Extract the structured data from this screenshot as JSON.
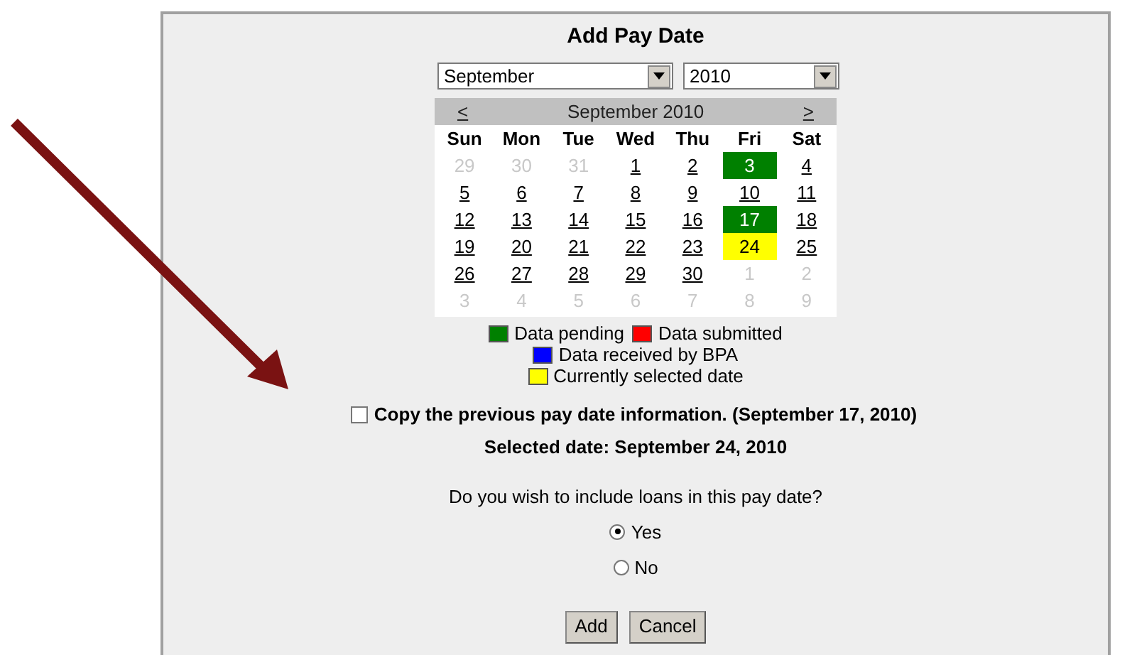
{
  "title": "Add Pay Date",
  "month_select": {
    "value": "September"
  },
  "year_select": {
    "value": "2010"
  },
  "calendar": {
    "prev": "<",
    "caption": "September 2010",
    "next": ">",
    "weekdays": [
      "Sun",
      "Mon",
      "Tue",
      "Wed",
      "Thu",
      "Fri",
      "Sat"
    ],
    "weeks": [
      [
        {
          "label": "29",
          "in_month": false
        },
        {
          "label": "30",
          "in_month": false
        },
        {
          "label": "31",
          "in_month": false
        },
        {
          "label": "1",
          "in_month": true
        },
        {
          "label": "2",
          "in_month": true
        },
        {
          "label": "3",
          "in_month": true,
          "color": "#008000"
        },
        {
          "label": "4",
          "in_month": true
        }
      ],
      [
        {
          "label": "5",
          "in_month": true
        },
        {
          "label": "6",
          "in_month": true
        },
        {
          "label": "7",
          "in_month": true
        },
        {
          "label": "8",
          "in_month": true
        },
        {
          "label": "9",
          "in_month": true
        },
        {
          "label": "10",
          "in_month": true
        },
        {
          "label": "11",
          "in_month": true
        }
      ],
      [
        {
          "label": "12",
          "in_month": true
        },
        {
          "label": "13",
          "in_month": true
        },
        {
          "label": "14",
          "in_month": true
        },
        {
          "label": "15",
          "in_month": true
        },
        {
          "label": "16",
          "in_month": true
        },
        {
          "label": "17",
          "in_month": true,
          "color": "#008000"
        },
        {
          "label": "18",
          "in_month": true
        }
      ],
      [
        {
          "label": "19",
          "in_month": true
        },
        {
          "label": "20",
          "in_month": true
        },
        {
          "label": "21",
          "in_month": true
        },
        {
          "label": "22",
          "in_month": true
        },
        {
          "label": "23",
          "in_month": true
        },
        {
          "label": "24",
          "in_month": true,
          "color": "#ffff00"
        },
        {
          "label": "25",
          "in_month": true
        }
      ],
      [
        {
          "label": "26",
          "in_month": true
        },
        {
          "label": "27",
          "in_month": true
        },
        {
          "label": "28",
          "in_month": true
        },
        {
          "label": "29",
          "in_month": true
        },
        {
          "label": "30",
          "in_month": true
        },
        {
          "label": "1",
          "in_month": false
        },
        {
          "label": "2",
          "in_month": false
        }
      ],
      [
        {
          "label": "3",
          "in_month": false
        },
        {
          "label": "4",
          "in_month": false
        },
        {
          "label": "5",
          "in_month": false
        },
        {
          "label": "6",
          "in_month": false
        },
        {
          "label": "7",
          "in_month": false
        },
        {
          "label": "8",
          "in_month": false
        },
        {
          "label": "9",
          "in_month": false
        }
      ]
    ]
  },
  "legend": [
    [
      {
        "label": "Data pending",
        "color": "#008000"
      },
      {
        "label": "Data submitted",
        "color": "#ff0000"
      }
    ],
    [
      {
        "label": "Data received by BPA",
        "color": "#0000ff"
      }
    ],
    [
      {
        "label": "Currently selected date",
        "color": "#ffff00"
      }
    ]
  ],
  "copy_checkbox": {
    "label": "Copy the previous pay date information. (September 17, 2010)",
    "checked": false
  },
  "selected_date": "Selected date: September 24, 2010",
  "question": "Do you wish to include loans in this pay date?",
  "options": [
    {
      "label": "Yes",
      "selected": true
    },
    {
      "label": "No",
      "selected": false
    }
  ],
  "buttons": [
    "Add",
    "Cancel"
  ]
}
